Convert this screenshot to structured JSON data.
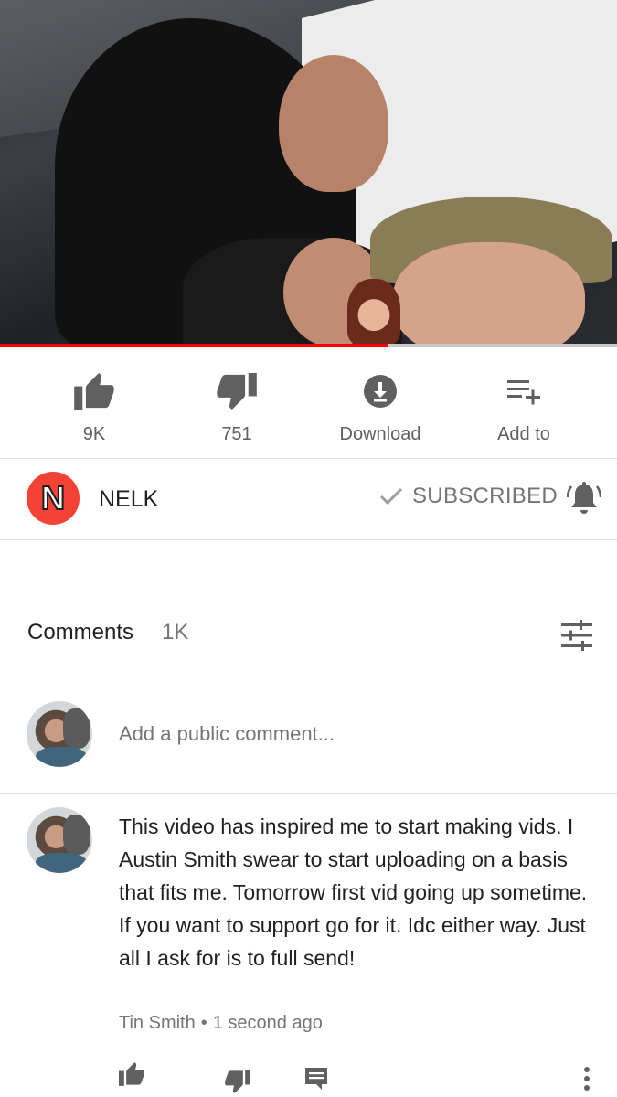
{
  "video": {
    "progress_fraction": 0.63,
    "accent_color": "#ff0000"
  },
  "actions": [
    {
      "icon": "thumb-up-icon",
      "label": "9K"
    },
    {
      "icon": "thumb-down-icon",
      "label": "751"
    },
    {
      "icon": "download-icon",
      "label": "Download"
    },
    {
      "icon": "playlist-add-icon",
      "label": "Add to"
    }
  ],
  "channel": {
    "avatar_letter": "N",
    "avatar_color": "#f44336",
    "name": "NELK",
    "subscribe_status": "SUBSCRIBED",
    "notification_icon": "bell-icon"
  },
  "comments": {
    "header": "Comments",
    "count": "1K",
    "sort_icon": "sort-sliders-icon",
    "add_placeholder": "Add a public comment...",
    "items": [
      {
        "text": "This video has inspired me to start making vids. I Austin Smith swear to start uploading on a basis that fits me. Tomorrow first vid going up sometime. If you want to support go for it. Idc either way. Just all I ask for is to full send!",
        "author": "Tin Smith",
        "separator": "•",
        "time": "1 second ago"
      }
    ]
  }
}
